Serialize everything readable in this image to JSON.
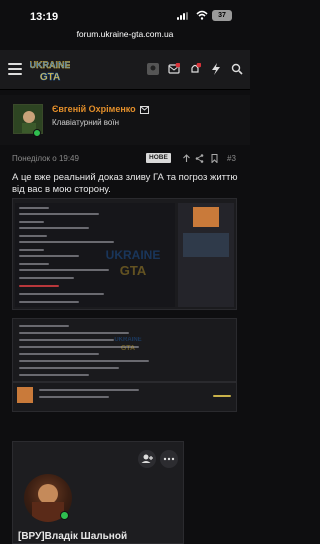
{
  "status_bar": {
    "time": "13:19",
    "battery": "37"
  },
  "browser": {
    "url": "forum.ukraine-gta.com.ua"
  },
  "site": {
    "logo_text_top": "UKRAINE",
    "logo_text_bottom": "GTA"
  },
  "author": {
    "name": "Євгеній Охріменко",
    "role": "Клавіатурний воїн"
  },
  "post": {
    "date": "Понеділок о 19:49",
    "badge": "НОВЕ",
    "number": "#3",
    "text": "А це вже реальний доказ зливу ГА та погроз життю від вас в мою сторону."
  },
  "next_post": {
    "name": "[ВРУ]Владік Шальной"
  },
  "colors": {
    "accent": "#e48f2a",
    "online": "#2fbf4f",
    "background": "#0e0e10"
  }
}
